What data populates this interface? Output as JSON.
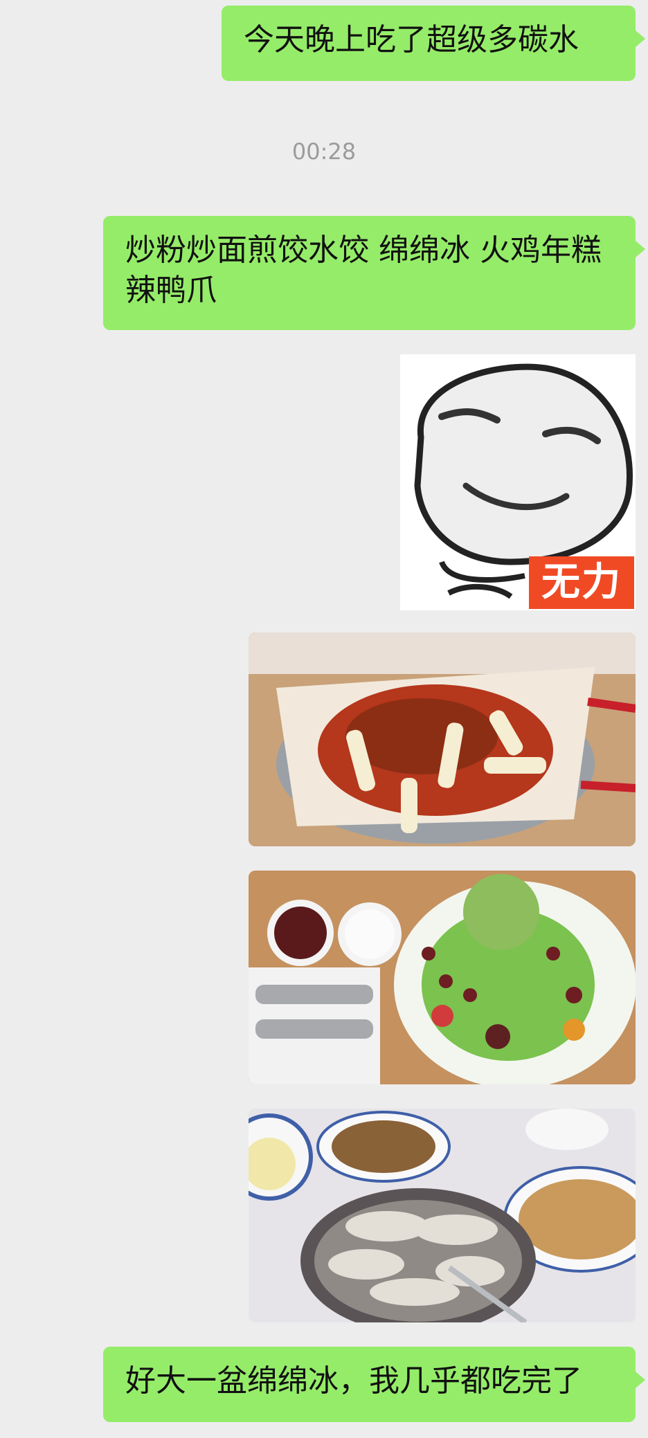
{
  "messages": {
    "m1": "今天晚上吃了超级多碳水",
    "time": "00:28",
    "m2": "炒粉炒面煎饺水饺 绵绵冰 火鸡年糕辣鸭爪",
    "sticker_text": "无力",
    "m3": "好大一盆绵绵冰，我几乎都吃完了"
  },
  "colors": {
    "background": "#ededed",
    "sent_bubble": "#95ec69",
    "timestamp": "#9b9b9b",
    "sticker_badge": "#f04a25"
  }
}
